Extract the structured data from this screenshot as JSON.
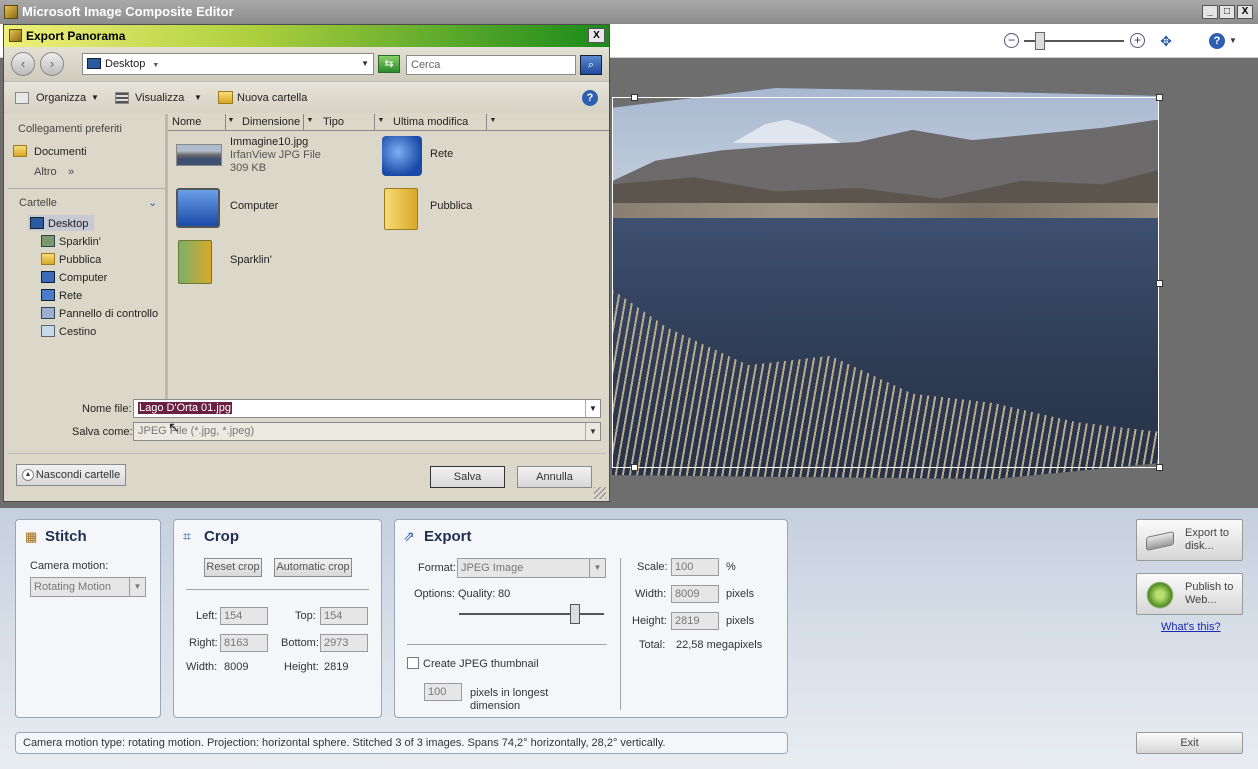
{
  "app": {
    "title": "Microsoft Image Composite Editor"
  },
  "window_buttons": {
    "minimize": "_",
    "maximize": "□",
    "close": "X"
  },
  "toolbar": {
    "help_label": "?"
  },
  "dialog": {
    "title": "Export Panorama",
    "close_label": "X",
    "location": "Desktop",
    "search_placeholder": "Cerca",
    "commands": {
      "organize": "Organizza",
      "view": "Visualizza",
      "new_folder": "Nuova cartella"
    },
    "nav_back": "‹",
    "nav_forward": "›",
    "favorites_header": "Collegamenti preferiti",
    "favorites": [
      "Documenti"
    ],
    "more_label": "Altro",
    "more_arrow": "»",
    "folders_header": "Cartelle",
    "tree": [
      "Desktop",
      "Sparklin'",
      "Pubblica",
      "Computer",
      "Rete",
      "Pannello di controllo",
      "Cestino"
    ],
    "columns": [
      "Nome",
      "Dimensione",
      "Tipo",
      "Ultima modifica"
    ],
    "files": [
      {
        "name": "Immagine10.jpg",
        "type": "IrfanView JPG File",
        "size": "309 KB"
      },
      {
        "name": "Rete"
      },
      {
        "name": "Computer"
      },
      {
        "name": "Pubblica"
      },
      {
        "name": "Sparklin'"
      }
    ],
    "filename_label": "Nome file:",
    "filename_value": "Lago D'Orta 01.jpg",
    "save_as_label": "Salva come:",
    "save_as_value": "JPEG File (*.jpg, *.jpeg)",
    "hide_folders": "Nascondi cartelle",
    "save": "Salva",
    "cancel": "Annulla"
  },
  "stitch": {
    "title": "Stitch",
    "camera_motion_label": "Camera motion:",
    "camera_motion_value": "Rotating Motion"
  },
  "crop": {
    "title": "Crop",
    "reset": "Reset crop",
    "automatic": "Automatic crop",
    "left_label": "Left:",
    "left": "154",
    "top_label": "Top:",
    "top": "154",
    "right_label": "Right:",
    "right": "8163",
    "bottom_label": "Bottom:",
    "bottom": "2973",
    "width_label": "Width:",
    "width": "8009",
    "height_label": "Height:",
    "height": "2819"
  },
  "export": {
    "title": "Export",
    "format_label": "Format:",
    "format_value": "JPEG Image",
    "options_label": "Options:",
    "quality_label": "Quality:",
    "quality": "80",
    "quality_fraction": 0.8,
    "thumbnail_label": "Create JPEG thumbnail",
    "thumb_size": "100",
    "thumb_unit": "pixels in longest dimension",
    "scale_label": "Scale:",
    "scale": "100",
    "scale_unit": "%",
    "width_label": "Width:",
    "width": "8009",
    "width_unit": "pixels",
    "height_label": "Height:",
    "height": "2819",
    "height_unit": "pixels",
    "total_label": "Total:",
    "total": "22,58 megapixels"
  },
  "actions": {
    "export_disk": "Export to disk...",
    "publish_web": "Publish to Web...",
    "whats_this": "What's this?",
    "exit": "Exit"
  },
  "status": "Camera motion type: rotating motion. Projection: horizontal sphere. Stitched 3 of 3 images. Spans 74,2° horizontally, 28,2° vertically."
}
